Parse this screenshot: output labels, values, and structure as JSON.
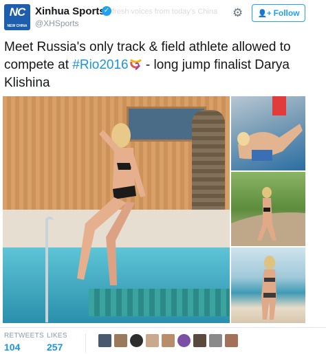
{
  "header": {
    "account_name": "Xinhua Sports",
    "handle": "@XHSports",
    "tagline": "fresh voices from today's China",
    "follow_label": "Follow",
    "avatar_text": "NC",
    "avatar_subtext": "NEW CHINA"
  },
  "tweet": {
    "text_before": "Meet Russia's only track & field athlete allowed to compete at ",
    "hashtag": "#Rio2016",
    "text_after": " - long jump finalist Darya Klishina"
  },
  "stats": {
    "retweets_label": "RETWEETS",
    "retweets_value": "104",
    "likes_label": "LIKES",
    "likes_value": "257"
  },
  "colors": {
    "accent": "#1da1f2",
    "link": "#1b95e0",
    "avatar_bg": "#1d5fae"
  },
  "icons": [
    "verified-badge-icon",
    "gear-icon",
    "follow-person-plus-icon",
    "olympic-ring-emoji-icon"
  ]
}
